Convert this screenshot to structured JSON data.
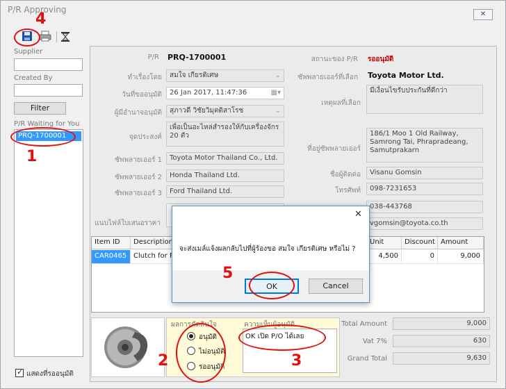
{
  "window": {
    "title": "P/R Approving",
    "close_glyph": "✕"
  },
  "toolbar": {
    "save_icon": "save-icon",
    "print_icon": "print-icon",
    "hourglass_icon": "hourglass-icon"
  },
  "left": {
    "supplier_label": "Supplier",
    "supplier_value": "",
    "created_by_label": "Created By",
    "created_by_value": "",
    "filter_label": "Filter",
    "waiting_label": "P/R Waiting for You",
    "waiting_items": [
      "PRQ-1700001"
    ],
    "show_approved_label": "แสดงที่รออนุมัติ",
    "show_approved_checked": true
  },
  "form": {
    "pr_label": "P/R",
    "pr_value": "PRQ-1700001",
    "status_label": "สถานะของ P/R",
    "status_value": "รออนุมัติ",
    "requester_label": "ทำเรื่องโดย",
    "requester_value": "สมใจ เกียรติเศษ",
    "approve_date_label": "วันที่ขออนุมัติ",
    "approve_date_value": "26 Jan  2017, 11:47:36",
    "approver_label": "ผู้มีอำนาจอนุมัติ",
    "approver_value": "สุภาวดี วิชัยวิมุตติสาโรช",
    "purpose_label": "จุดประสงค์",
    "purpose_value": "เพื่อเป็นอะไหล่สำรองให้กับเครื่องจักร 20 ตัว",
    "supplier1_label": "ซัพพลายเออร์ 1",
    "supplier1_value": "Toyota Motor Thailand Co., Ltd.",
    "supplier2_label": "ซัพพลายเออร์ 2",
    "supplier2_value": "Honda Thailand Ltd.",
    "supplier3_label": "ซัพพลายเออร์ 3",
    "supplier3_value": "Ford Thailand Ltd.",
    "attach_label": "แนบไฟล์ใบเสนอราคา",
    "chosen_supplier_label": "ซัพพลายเออร์ที่เลือก",
    "chosen_supplier_value": "Toyota Motor Ltd.",
    "reason_label": "เหตุผลที่เลือก",
    "reason_value": "มีเงื่อนไขรับประกันที่ดีกว่า",
    "address_label": "ที่อยู่ซัพพลายเออร์",
    "address_value": "186/1 Moo 1 Old Railway, Samrong Tai, Phrapradeang, Samutprakarn",
    "contact_label": "ชื่อผู้ติดต่อ",
    "contact_value": "Visanu Gomsin",
    "phone_label": "โทรศัพท์",
    "phone_value": "098-7231653",
    "fax_value": "038-443768",
    "email_value": "vgomsin@toyota.co.th"
  },
  "grid": {
    "columns": [
      "Item ID",
      "Description",
      "Unit",
      "Discount",
      "Amount"
    ],
    "rows": [
      {
        "item_id": "CAR0465",
        "description": "Clutch for Fo",
        "unit": "4,500",
        "discount": "0",
        "amount": "9,000"
      }
    ]
  },
  "result": {
    "result_label": "ผลการตัดสินใจ",
    "options": [
      "อนุมัติ",
      "ไม่อนุมัติ",
      "รออนุมัติ"
    ],
    "selected": "อนุมัติ",
    "comment_label": "ความเห็นผู้อนุมัติ",
    "comment_value": "OK เปิด P/O ได้เลย"
  },
  "totals": {
    "total_label": "Total Amount",
    "total_value": "9,000",
    "vat_label": "Vat 7%",
    "vat_value": "630",
    "grand_label": "Grand Total",
    "grand_value": "9,630"
  },
  "dialog": {
    "message": "จะส่งเมล์แจ้งผลกลับไปที่ผู้ร้องขอ สมใจ เกียรติเศษ หรือไม่ ?",
    "ok_label": "OK",
    "cancel_label": "Cancel",
    "close_glyph": "✕"
  },
  "annotations": {
    "n1": "1",
    "n2": "2",
    "n3": "3",
    "n4": "4",
    "n5": "5"
  },
  "colors": {
    "annotation": "#e01010",
    "selection": "#3399ff",
    "dialog_border": "#5a8fd0"
  }
}
